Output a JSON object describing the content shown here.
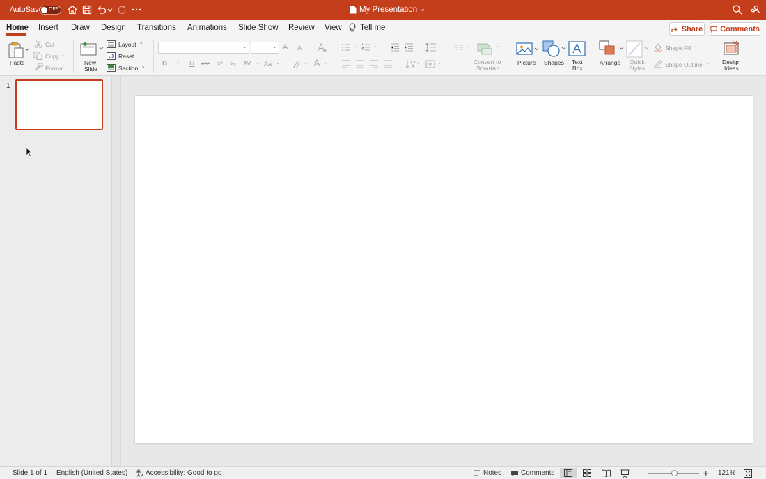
{
  "titlebar": {
    "autosave_label": "AutoSave",
    "autosave_state": "OFF",
    "document_title": "My Presentation",
    "icons": [
      "home-icon",
      "save-icon",
      "undo-icon",
      "redo-icon",
      "more-icon",
      "search-icon",
      "share-people-icon"
    ]
  },
  "tabs": [
    {
      "label": "Home",
      "active": true
    },
    {
      "label": "Insert"
    },
    {
      "label": "Draw"
    },
    {
      "label": "Design"
    },
    {
      "label": "Transitions"
    },
    {
      "label": "Animations"
    },
    {
      "label": "Slide Show"
    },
    {
      "label": "Review"
    },
    {
      "label": "View"
    },
    {
      "label": "Tell me"
    }
  ],
  "top_right": {
    "share_label": "Share",
    "comments_label": "Comments"
  },
  "ribbon": {
    "clipboard": {
      "paste": "Paste",
      "cut": "Cut",
      "copy": "Copy",
      "format": "Format"
    },
    "slides": {
      "new_slide_line1": "New",
      "new_slide_line2": "Slide",
      "layout": "Layout",
      "reset": "Reset",
      "section": "Section"
    },
    "font": {
      "font_name": "",
      "font_size": "",
      "bold": "B",
      "italic": "I",
      "underline": "U",
      "strike": "abc",
      "superscript": "x²",
      "subscript": "x₂",
      "spacing": "AV",
      "case": "Aa",
      "grow": "A",
      "shrink": "A"
    },
    "convert_smartart_line1": "Convert to",
    "convert_smartart_line2": "SmartArt",
    "picture": "Picture",
    "shapes": "Shapes",
    "textbox_line1": "Text",
    "textbox_line2": "Box",
    "arrange": "Arrange",
    "quick_styles_line1": "Quick",
    "quick_styles_line2": "Styles",
    "shape_fill": "Shape Fill",
    "shape_outline": "Shape Outline",
    "design_ideas_line1": "Design",
    "design_ideas_line2": "Ideas"
  },
  "thumbnails": [
    {
      "number": "1"
    }
  ],
  "statusbar": {
    "slide_count": "Slide 1 of 1",
    "language": "English (United States)",
    "accessibility": "Accessibility: Good to go",
    "notes": "Notes",
    "comments": "Comments",
    "zoom_minus": "−",
    "zoom_plus": "+",
    "zoom_level": "121%",
    "zoom_fraction": 0.52
  },
  "colors": {
    "accent": "#c43e1c",
    "ribbon_bg": "#f4f4f4",
    "disabled_text": "#9a9a9a"
  }
}
